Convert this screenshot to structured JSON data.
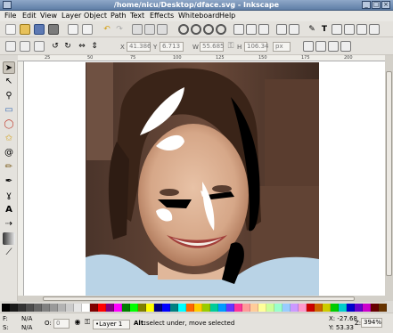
{
  "window": {
    "title": "/home/nicu/Desktop/dface.svg - Inkscape",
    "min_btn": "_",
    "max_btn": "□",
    "close_btn": "×"
  },
  "menu": {
    "items": [
      "File",
      "Edit",
      "View",
      "Layer",
      "Object",
      "Path",
      "Text",
      "Effects",
      "Whiteboard",
      "Help"
    ]
  },
  "toolbar": {
    "x_label": "X",
    "x_value": "41.386",
    "y_label": "Y",
    "y_value": "6.713",
    "w_label": "W",
    "w_value": "55.685",
    "h_label": "H",
    "h_value": "106.34",
    "unit": "px"
  },
  "tools": [
    "select-arrow",
    "node-arrow",
    "zoom",
    "rectangle",
    "circle",
    "star",
    "spiral",
    "pencil",
    "pen",
    "calligraphy",
    "text",
    "connector",
    "gradient",
    "dropper"
  ],
  "palette": {
    "colors": [
      "#000000",
      "#1a1a1a",
      "#333333",
      "#4d4d4d",
      "#666666",
      "#808080",
      "#999999",
      "#b3b3b3",
      "#cccccc",
      "#e6e6e6",
      "#ffffff",
      "#800000",
      "#ff0000",
      "#800080",
      "#ff00ff",
      "#008000",
      "#00ff00",
      "#808000",
      "#ffff00",
      "#000080",
      "#0000ff",
      "#008080",
      "#00ffff",
      "#ff6600",
      "#ffcc00",
      "#99cc00",
      "#00cc99",
      "#0099ff",
      "#6633ff",
      "#ff3399",
      "#ff9999",
      "#ffcc99",
      "#ffff99",
      "#ccff99",
      "#99ffcc",
      "#99ccff",
      "#cc99ff",
      "#ff99cc",
      "#cc0000",
      "#cc6600",
      "#cccc00",
      "#00cc00",
      "#00cccc",
      "#0000cc",
      "#6600cc",
      "#cc00cc",
      "#660000",
      "#663300"
    ]
  },
  "status": {
    "fill_label": "F:",
    "fill_value": "N/A",
    "stroke_label": "S:",
    "stroke_value": "N/A",
    "opacity_label": "O:",
    "opacity_value": "0",
    "layer": "•Layer 1",
    "message_bold": "Alt:",
    "message": " select under, move selected",
    "x_coord": "X: -27.68",
    "y_coord": "Y:  53.33",
    "zoom_label": "Z:",
    "zoom_value": "394%"
  },
  "ruler": {
    "ticks": [
      "25",
      "50",
      "75",
      "100",
      "125",
      "150",
      "175",
      "200"
    ]
  }
}
